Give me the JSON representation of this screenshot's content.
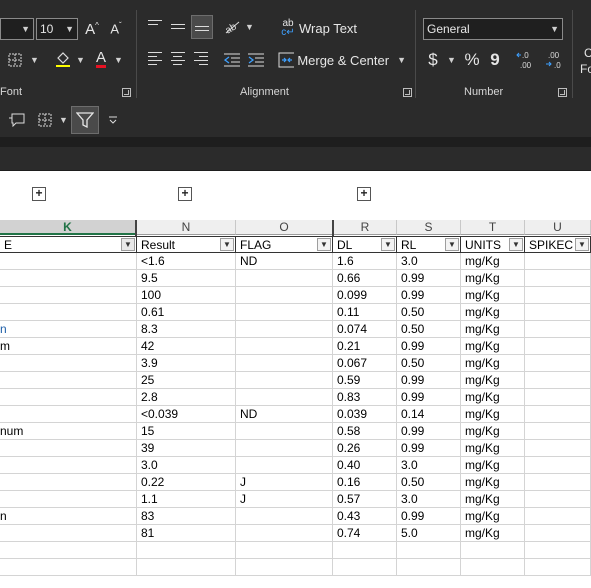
{
  "ribbon": {
    "font_size": "10",
    "grow_font": "A^",
    "shrink_font": "Aˇ",
    "wrap_text_label": "Wrap Text",
    "merge_center_label": "Merge & Center",
    "number_format": "General",
    "currency_symbol": "$",
    "percent_symbol": "%",
    "comma_symbol": "9",
    "inc_decimal": "←.0\n.00",
    "dec_decimal": ".00\n→.0",
    "cond_format_partial": "C",
    "cond_format_partial2": "Fo",
    "groups": {
      "font": "Font",
      "alignment": "Alignment",
      "number": "Number"
    }
  },
  "column_headers": [
    "K",
    "N",
    "O",
    "R",
    "S",
    "T",
    "U"
  ],
  "table": {
    "headers": [
      "E",
      "Result",
      "FLAG",
      "DL",
      "RL",
      "UNITS",
      "SPIKEC"
    ],
    "rows": [
      [
        "",
        "<1.6",
        "ND",
        "1.6",
        "3.0",
        "mg/Kg",
        ""
      ],
      [
        "",
        "9.5",
        "",
        "0.66",
        "0.99",
        "mg/Kg",
        ""
      ],
      [
        "",
        "100",
        "",
        "0.099",
        "0.99",
        "mg/Kg",
        ""
      ],
      [
        "",
        "0.61",
        "",
        "0.11",
        "0.50",
        "mg/Kg",
        ""
      ],
      [
        "n",
        "8.3",
        "",
        "0.074",
        "0.50",
        "mg/Kg",
        ""
      ],
      [
        "m",
        "42",
        "",
        "0.21",
        "0.99",
        "mg/Kg",
        ""
      ],
      [
        "",
        "3.9",
        "",
        "0.067",
        "0.50",
        "mg/Kg",
        ""
      ],
      [
        "",
        "25",
        "",
        "0.59",
        "0.99",
        "mg/Kg",
        ""
      ],
      [
        "",
        "2.8",
        "",
        "0.83",
        "0.99",
        "mg/Kg",
        ""
      ],
      [
        "",
        "<0.039",
        "ND",
        "0.039",
        "0.14",
        "mg/Kg",
        ""
      ],
      [
        "num",
        "15",
        "",
        "0.58",
        "0.99",
        "mg/Kg",
        ""
      ],
      [
        "",
        "39",
        "",
        "0.26",
        "0.99",
        "mg/Kg",
        ""
      ],
      [
        "",
        "3.0",
        "",
        "0.40",
        "3.0",
        "mg/Kg",
        ""
      ],
      [
        "",
        "0.22",
        "J",
        "0.16",
        "0.50",
        "mg/Kg",
        ""
      ],
      [
        "",
        "1.1",
        "J",
        "0.57",
        "3.0",
        "mg/Kg",
        ""
      ],
      [
        "n",
        "83",
        "",
        "0.43",
        "0.99",
        "mg/Kg",
        ""
      ],
      [
        "",
        "81",
        "",
        "0.74",
        "5.0",
        "mg/Kg",
        ""
      ]
    ]
  },
  "colors": {
    "ribbon_bg": "#2b2b2b",
    "font_color_underline": "#e81123",
    "selected_header": "#217346",
    "hyperlink_text": "#1f5fa8"
  }
}
